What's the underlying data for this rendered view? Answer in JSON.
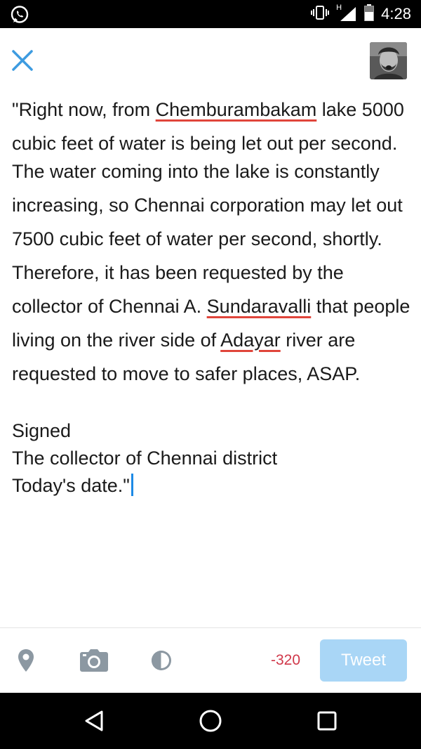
{
  "status_bar": {
    "left_icon": "whatsapp-icon",
    "network_label": "H",
    "time": "4:28",
    "icons": [
      "vibrate-icon",
      "signal-icon",
      "battery-icon"
    ]
  },
  "header": {
    "close_icon": "close-icon",
    "avatar_icon": "avatar"
  },
  "compose": {
    "p1": {
      "before": "\"Right now, from ",
      "misspelled": "Chemburambakam",
      "after": " lake 5000 cubic feet of water is being let out per second."
    },
    "p2": {
      "text1": "The water coming into the lake is constantly increasing, so Chennai corporation may let out 7500 cubic feet of water per second, shortly. Therefore, it has been requested by the collector of Chennai A. ",
      "misspelled1": "Sundaravalli",
      "text2": " that people living on the river side of ",
      "misspelled2": "Adayar",
      "text3": " river are requested to move to safer places, ASAP."
    },
    "signed": "Signed",
    "signed_by": "The collector of Chennai district",
    "date_line": "Today's date.\""
  },
  "toolbar": {
    "icons": [
      "location-pin-icon",
      "camera-icon",
      "poll-icon"
    ],
    "char_count": "-320",
    "tweet_label": "Tweet",
    "colors": {
      "counter": "#d0384a",
      "tweet_button_disabled": "#a9d6f6",
      "accent": "#1d8ae6",
      "spell_underline": "#e0453b"
    }
  },
  "nav_bar": {
    "icons": [
      "back-icon",
      "home-icon",
      "recents-icon"
    ]
  }
}
